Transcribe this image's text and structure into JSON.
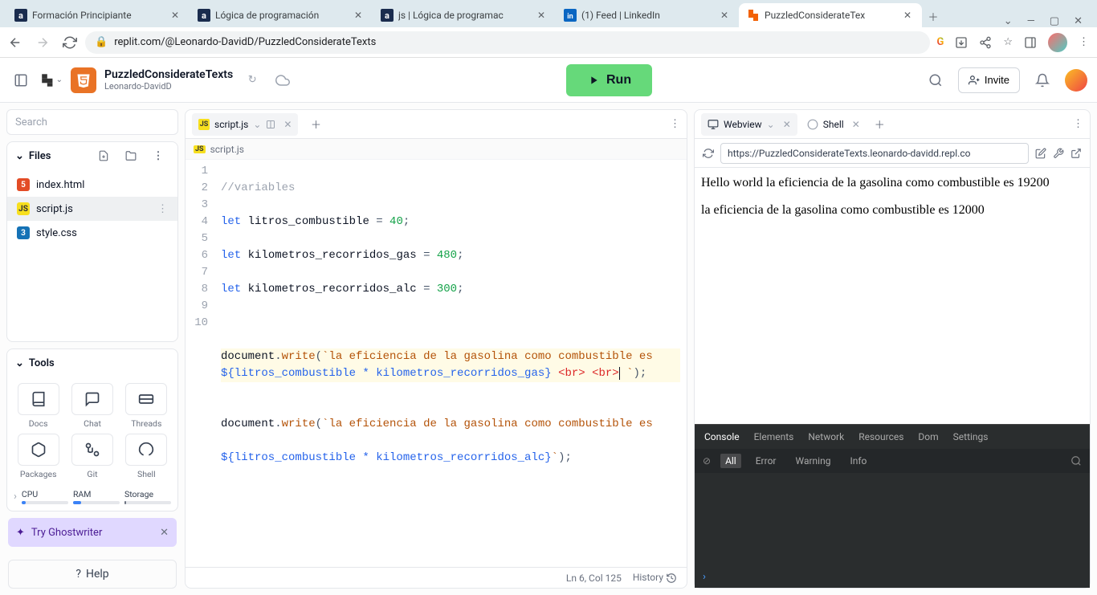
{
  "browser": {
    "tabs": [
      {
        "title": "Formación Principiante",
        "favicon": "alura"
      },
      {
        "title": "Lógica de programación",
        "favicon": "alura"
      },
      {
        "title": "js | Lógica de programac",
        "favicon": "alura"
      },
      {
        "title": "(1) Feed | LinkedIn",
        "favicon": "linkedin"
      },
      {
        "title": "PuzzledConsiderateTex",
        "favicon": "replit",
        "active": true
      }
    ],
    "url": "replit.com/@Leonardo-DavidD/PuzzledConsiderateTexts"
  },
  "header": {
    "project_name": "PuzzledConsiderateTexts",
    "project_owner": "Leonardo-DavidD",
    "run_label": "Run",
    "invite_label": "Invite"
  },
  "sidebar": {
    "search_placeholder": "Search",
    "files_label": "Files",
    "files": [
      {
        "name": "index.html",
        "type": "html5"
      },
      {
        "name": "script.js",
        "type": "js",
        "selected": true
      },
      {
        "name": "style.css",
        "type": "css3"
      }
    ],
    "tools_label": "Tools",
    "tools": [
      {
        "label": "Docs",
        "icon": "docs"
      },
      {
        "label": "Chat",
        "icon": "chat"
      },
      {
        "label": "Threads",
        "icon": "threads"
      },
      {
        "label": "Packages",
        "icon": "packages"
      },
      {
        "label": "Git",
        "icon": "git"
      },
      {
        "label": "Shell",
        "icon": "shell"
      }
    ],
    "stats": [
      {
        "label": "CPU",
        "pct": 8,
        "color": "#3b82f6"
      },
      {
        "label": "RAM",
        "pct": 18,
        "color": "#3b82f6"
      },
      {
        "label": "Storage",
        "pct": 4,
        "color": "#6b7280"
      }
    ],
    "ghostwriter_label": "Try Ghostwriter",
    "help_label": "Help"
  },
  "editor": {
    "tab_label": "script.js",
    "breadcrumb": "script.js",
    "lines": [
      "1",
      "2",
      "3",
      "4",
      "5",
      "6",
      "",
      "7",
      "8",
      "",
      "9",
      "10"
    ],
    "code": {
      "l1_comment": "//variables",
      "l2_kw": "let",
      "l2_var": " litros_combustible ",
      "l2_op": "=",
      "l2_num": " 40",
      "l2_end": ";",
      "l3_kw": "let",
      "l3_var": " kilometros_recorridos_gas ",
      "l3_op": "=",
      "l3_num": " 480",
      "l3_end": ";",
      "l4_kw": "let",
      "l4_var": " kilometros_recorridos_alc ",
      "l4_op": "=",
      "l4_num": " 300",
      "l4_end": ";",
      "l6_a": "document",
      "l6_dot": ".",
      "l6_m": "write",
      "l6_p1": "(",
      "l6_s1": "`la eficiencia de la gasolina como combustible es ",
      "l6b_i": "${litros_combustible * kilometros_recorridos_gas}",
      "l6b_t1": " <br>",
      "l6b_t2": " <br>",
      "l6b_s2": " `",
      "l6b_p2": ")",
      "l6b_end": ";",
      "l8_a": "document",
      "l8_dot": ".",
      "l8_m": "write",
      "l8_p1": "(",
      "l8_s1": "`la eficiencia de la gasolina como combustible es ",
      "l8b_i": "${litros_combustible * kilometros_recorridos_alc}",
      "l8b_s2": "`",
      "l8b_p2": ")",
      "l8b_end": ";"
    },
    "status_pos": "Ln 6, Col 125",
    "status_history": "History"
  },
  "webview": {
    "tab1": "Webview",
    "tab2": "Shell",
    "url": "https://PuzzledConsiderateTexts.leonardo-davidd.repl.co",
    "line1": "Hello world la eficiencia de la gasolina como combustible es 19200",
    "line2": "la eficiencia de la gasolina como combustible es 12000"
  },
  "devtools": {
    "tabs": [
      "Console",
      "Elements",
      "Network",
      "Resources",
      "Dom",
      "Settings"
    ],
    "active_tab": 0,
    "filters": [
      "All",
      "Error",
      "Warning",
      "Info"
    ],
    "active_filter": 0
  }
}
